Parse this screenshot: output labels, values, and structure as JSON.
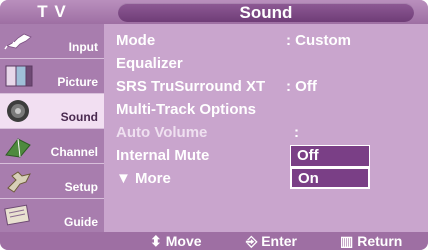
{
  "header": {
    "device_label": "T V",
    "title": "Sound"
  },
  "sidebar": {
    "items": [
      {
        "label": "Input",
        "icon": "plug-icon"
      },
      {
        "label": "Picture",
        "icon": "picture-icon"
      },
      {
        "label": "Sound",
        "icon": "speaker-icon"
      },
      {
        "label": "Channel",
        "icon": "antenna-icon"
      },
      {
        "label": "Setup",
        "icon": "gear-icon"
      },
      {
        "label": "Guide",
        "icon": "guide-icon"
      }
    ],
    "active_index": 2
  },
  "menu": {
    "rows": [
      {
        "label": "Mode",
        "value": ": Custom"
      },
      {
        "label": "Equalizer",
        "value": ""
      },
      {
        "label": "SRS TruSurround XT",
        "value": ": Off"
      },
      {
        "label": "Multi-Track Options",
        "value": ""
      },
      {
        "label": "Auto Volume",
        "value": ":"
      },
      {
        "label": "Internal Mute",
        "value": ":"
      },
      {
        "label": "▼ More",
        "value": ""
      }
    ],
    "dropdown": {
      "options": [
        "Off",
        "On"
      ],
      "highlighted": "Off",
      "selected": "On"
    }
  },
  "footer": {
    "move": "Move",
    "enter": "Enter",
    "return": "Return",
    "move_icon": "updown-arrows-icon",
    "enter_icon": "enter-icon",
    "return_icon": "menu-return-icon"
  },
  "colors": {
    "background": "#c9a5cd",
    "sidebar": "#a87dae",
    "active_item": "#f2dff2",
    "highlight": "#7a3f86"
  }
}
